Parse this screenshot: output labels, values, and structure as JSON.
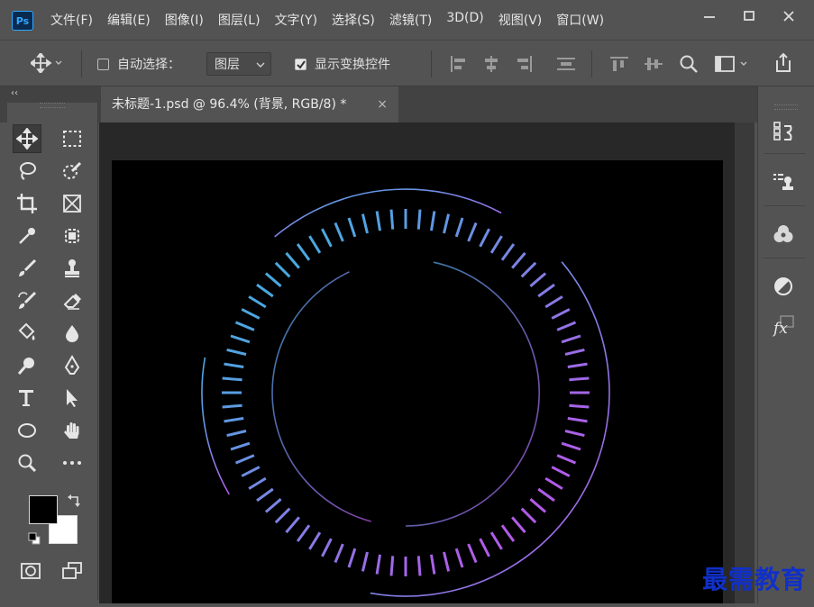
{
  "app": {
    "logo": "Ps"
  },
  "menu": [
    "文件(F)",
    "编辑(E)",
    "图像(I)",
    "图层(L)",
    "文字(Y)",
    "选择(S)",
    "滤镜(T)",
    "3D(D)",
    "视图(V)",
    "窗口(W)"
  ],
  "options": {
    "auto_select_label": "自动选择：",
    "auto_select_checked": false,
    "auto_select_target": "图层",
    "show_transform_label": "显示变换控件",
    "show_transform_checked": true
  },
  "document": {
    "tab_title": "未标题-1.psd @ 96.4% (背景, RGB/8) *",
    "close_glyph": "×"
  },
  "colors": {
    "foreground": "#000000",
    "background": "#ffffff",
    "gradient_start": "#4aa8e0",
    "gradient_end": "#b25be8"
  },
  "tools": [
    "move-tool",
    "marquee-tool",
    "lasso-tool",
    "quick-select-tool",
    "crop-tool",
    "frame-tool",
    "eyedropper-tool",
    "spot-healing-tool",
    "brush-tool",
    "stamp-tool",
    "history-brush-tool",
    "eraser-tool",
    "paint-bucket-tool",
    "blur-tool",
    "dodge-tool",
    "pen-tool",
    "type-tool",
    "path-select-tool",
    "ellipse-tool",
    "hand-tool",
    "zoom-tool",
    "more-tools",
    "quick-mask-tool",
    "screen-mode-tool"
  ],
  "right_panel_icons": [
    "history-icon",
    "layer-comps-icon",
    "channels-icon",
    "adjustments-icon",
    "styles-icon"
  ],
  "watermark": "最需教育"
}
